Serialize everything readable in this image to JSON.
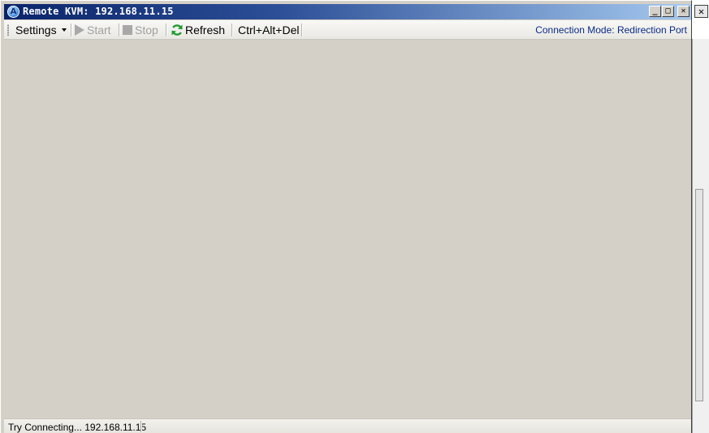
{
  "window": {
    "title": "Remote KVM: 192.168.11.15",
    "app_icon_letter": "A",
    "minimize_glyph": "_",
    "maximize_glyph": "□",
    "close_glyph": "✕"
  },
  "toolbar": {
    "settings_label": "Settings",
    "start_label": "Start",
    "stop_label": "Stop",
    "refresh_label": "Refresh",
    "cad_label": "Ctrl+Alt+Del",
    "connection_mode": "Connection Mode: Redirection Port"
  },
  "statusbar": {
    "status": "Try Connecting... 192.168.11.15"
  },
  "background": {
    "close_glyph": "✕"
  },
  "colors": {
    "title_gradient_start": "#0a246a",
    "title_gradient_end": "#a6caf0",
    "connection_mode_text": "#0a2a8a",
    "refresh_icon": "#1f9a2e",
    "disabled": "#a0a0a0"
  },
  "icons": {
    "app": "remote-kvm-app-icon",
    "start": "play-icon",
    "stop": "stop-icon",
    "refresh": "refresh-icon",
    "settings_dropdown": "caret-down-icon"
  }
}
